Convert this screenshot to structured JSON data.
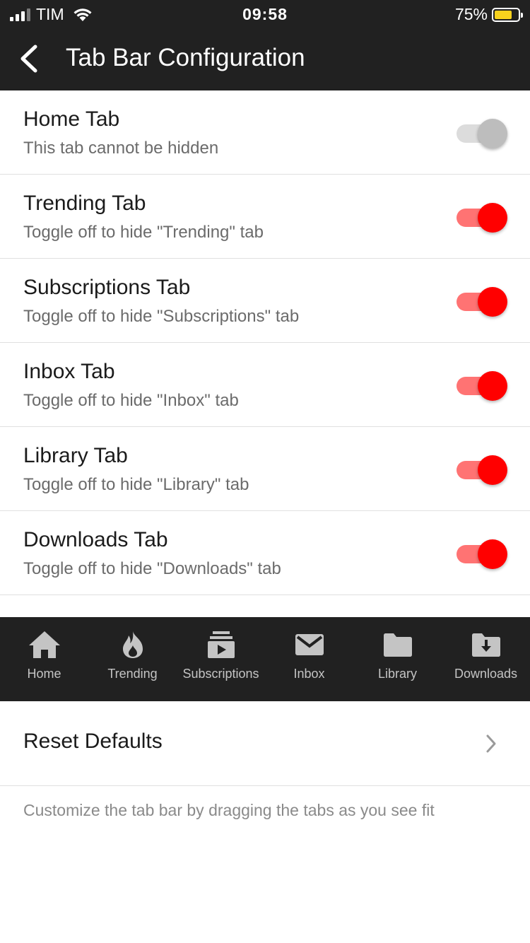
{
  "status_bar": {
    "carrier": "TIM",
    "time": "09:58",
    "battery": "75%",
    "battery_level": 0.75
  },
  "nav": {
    "title": "Tab Bar Configuration"
  },
  "rows": [
    {
      "title": "Home Tab",
      "subtitle": "This tab cannot be hidden",
      "enabled": false
    },
    {
      "title": "Trending Tab",
      "subtitle": "Toggle off to hide \"Trending\" tab",
      "enabled": true
    },
    {
      "title": "Subscriptions Tab",
      "subtitle": "Toggle off to hide \"Subscriptions\" tab",
      "enabled": true
    },
    {
      "title": "Inbox Tab",
      "subtitle": "Toggle off to hide \"Inbox\" tab",
      "enabled": true
    },
    {
      "title": "Library Tab",
      "subtitle": "Toggle off to hide \"Library\" tab",
      "enabled": true
    },
    {
      "title": "Downloads Tab",
      "subtitle": "Toggle off to hide \"Downloads\" tab",
      "enabled": true
    }
  ],
  "tabbar": {
    "items": [
      {
        "label": "Home",
        "icon": "home-icon"
      },
      {
        "label": "Trending",
        "icon": "flame-icon"
      },
      {
        "label": "Subscriptions",
        "icon": "subscriptions-icon"
      },
      {
        "label": "Inbox",
        "icon": "mail-icon"
      },
      {
        "label": "Library",
        "icon": "folder-icon"
      },
      {
        "label": "Downloads",
        "icon": "download-folder-icon"
      }
    ]
  },
  "reset": {
    "label": "Reset Defaults"
  },
  "footer": {
    "text": "Customize the tab bar by dragging the tabs as you see fit"
  },
  "colors": {
    "accent": "#ff0000",
    "accent_track": "#ff7373",
    "bar_bg": "#212121"
  }
}
